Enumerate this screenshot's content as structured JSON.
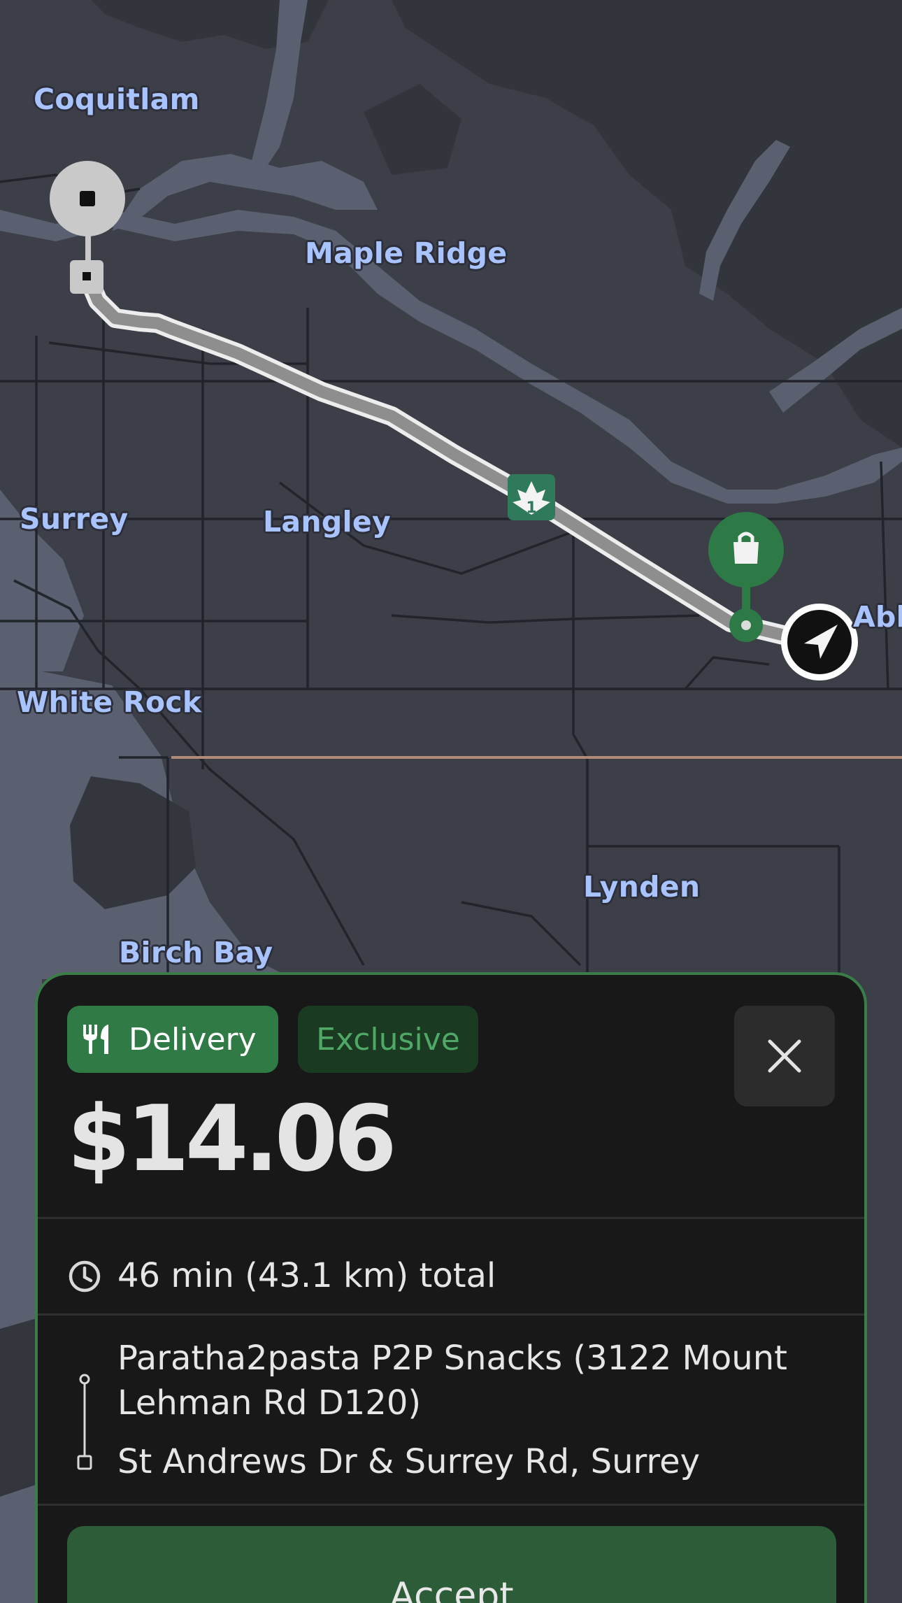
{
  "map": {
    "labels": {
      "coquitlam": "Coquitlam",
      "maple_ridge": "Maple Ridge",
      "surrey": "Surrey",
      "langley": "Langley",
      "white_rock": "White Rock",
      "abbotsford_partial": "Abb",
      "lynden": "Lynden",
      "birch_bay": "Birch Bay"
    },
    "highway_shield": "1",
    "colors": {
      "land": "#3d3f48",
      "water": "#5b6071",
      "route": "#8e8e8e",
      "pickup": "#2e7a47",
      "label": "#a9c3ff"
    }
  },
  "card": {
    "chips": {
      "delivery": "Delivery",
      "exclusive": "Exclusive"
    },
    "fare": "$14.06",
    "trip_summary": "46 min (43.1 km) total",
    "pickup_line1": "Paratha2pasta P2P Snacks (3122 Mount",
    "pickup_line2": "Lehman Rd D120)",
    "dropoff": "St Andrews Dr & Surrey Rd, Surrey",
    "accept_label": "Accept",
    "accent_color": "#3a7d48"
  }
}
